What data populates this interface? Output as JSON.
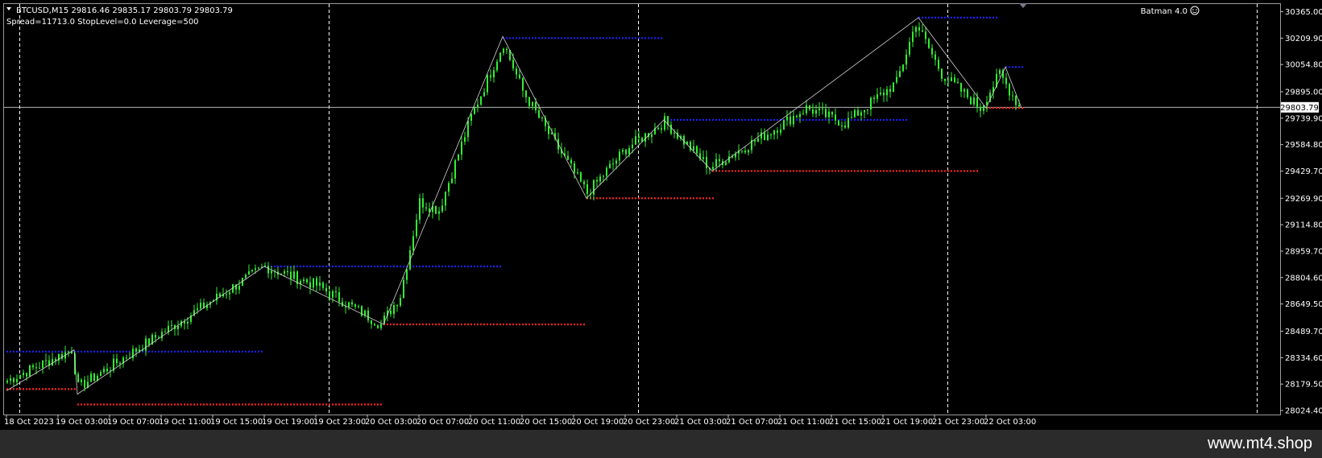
{
  "header": {
    "symbol_line": "BTCUSD,M15  29816.46 29835.17 29803.79 29803.79",
    "info_line": "Spread=11713.0  StopLevel=0.0  Leverage=500",
    "indicator": "Batman 4.0"
  },
  "colors": {
    "background": "#000000",
    "candle": "#33ee33",
    "zigzag": "#cfcfcf",
    "resistance": "#1f1fff",
    "support": "#ff2020",
    "grid": "#ffffff"
  },
  "watermark": "www.mt4.shop",
  "chart_data": {
    "type": "candlestick",
    "ylim": [
      28024.4,
      30365.0
    ],
    "x_index_range": [
      0,
      364
    ],
    "current_price": "29803.79",
    "price_ticks": [
      "30365.00",
      "30209.90",
      "30054.80",
      "29895.00",
      "29739.90",
      "29584.80",
      "29429.70",
      "29269.90",
      "29114.80",
      "28959.70",
      "28804.60",
      "28649.50",
      "28489.70",
      "28334.60",
      "28179.50",
      "28024.40"
    ],
    "time_ticks": [
      {
        "label": "18 Oct 2023",
        "index": 0
      },
      {
        "label": "19 Oct 03:00",
        "index": 16
      },
      {
        "label": "19 Oct 07:00",
        "index": 32
      },
      {
        "label": "19 Oct 11:00",
        "index": 48
      },
      {
        "label": "19 Oct 15:00",
        "index": 64
      },
      {
        "label": "19 Oct 19:00",
        "index": 80
      },
      {
        "label": "19 Oct 23:00",
        "index": 96
      },
      {
        "label": "20 Oct 03:00",
        "index": 112
      },
      {
        "label": "20 Oct 07:00",
        "index": 128
      },
      {
        "label": "20 Oct 11:00",
        "index": 144
      },
      {
        "label": "20 Oct 15:00",
        "index": 160
      },
      {
        "label": "20 Oct 19:00",
        "index": 176
      },
      {
        "label": "20 Oct 23:00",
        "index": 192
      },
      {
        "label": "21 Oct 03:00",
        "index": 208
      },
      {
        "label": "21 Oct 07:00",
        "index": 224
      },
      {
        "label": "21 Oct 11:00",
        "index": 240
      },
      {
        "label": "21 Oct 15:00",
        "index": 256
      },
      {
        "label": "21 Oct 19:00",
        "index": 272
      },
      {
        "label": "21 Oct 23:00",
        "index": 288
      },
      {
        "label": "22 Oct 03:00",
        "index": 304
      }
    ],
    "day_separators": [
      4,
      100,
      196,
      292,
      388
    ],
    "path": [
      [
        0,
        28200
      ],
      [
        20,
        28380
      ],
      [
        22,
        28160
      ],
      [
        80,
        28870
      ],
      [
        96,
        28760
      ],
      [
        116,
        28530
      ],
      [
        122,
        28700
      ],
      [
        128,
        29250
      ],
      [
        134,
        29200
      ],
      [
        144,
        29750
      ],
      [
        154,
        30180
      ],
      [
        160,
        29900
      ],
      [
        168,
        29650
      ],
      [
        180,
        29300
      ],
      [
        192,
        29560
      ],
      [
        204,
        29720
      ],
      [
        218,
        29450
      ],
      [
        236,
        29650
      ],
      [
        248,
        29800
      ],
      [
        260,
        29710
      ],
      [
        276,
        29950
      ],
      [
        282,
        30300
      ],
      [
        290,
        30000
      ],
      [
        302,
        29800
      ],
      [
        308,
        30000
      ],
      [
        314,
        29810
      ]
    ],
    "zigzag": [
      [
        0,
        28140
      ],
      [
        21,
        28380
      ],
      [
        22,
        28120
      ],
      [
        80,
        28870
      ],
      [
        117,
        28530
      ],
      [
        154,
        30220
      ],
      [
        180,
        29270
      ],
      [
        204,
        29730
      ],
      [
        219,
        29430
      ],
      [
        283,
        30330
      ],
      [
        304,
        29800
      ],
      [
        310,
        30040
      ],
      [
        315,
        29800
      ]
    ],
    "resistance_levels": [
      {
        "price": 28370,
        "x0": 0,
        "x1": 80
      },
      {
        "price": 28870,
        "x0": 80,
        "x1": 154
      },
      {
        "price": 30210,
        "x0": 154,
        "x1": 204
      },
      {
        "price": 29730,
        "x0": 204,
        "x1": 280
      },
      {
        "price": 30330,
        "x0": 283,
        "x1": 308
      },
      {
        "price": 30040,
        "x0": 310,
        "x1": 316
      }
    ],
    "support_levels": [
      {
        "price": 28150,
        "x0": 0,
        "x1": 22
      },
      {
        "price": 28060,
        "x0": 22,
        "x1": 117
      },
      {
        "price": 28530,
        "x0": 117,
        "x1": 180
      },
      {
        "price": 29270,
        "x0": 180,
        "x1": 220
      },
      {
        "price": 29430,
        "x0": 219,
        "x1": 302
      },
      {
        "price": 29800,
        "x0": 304,
        "x1": 316
      }
    ]
  }
}
